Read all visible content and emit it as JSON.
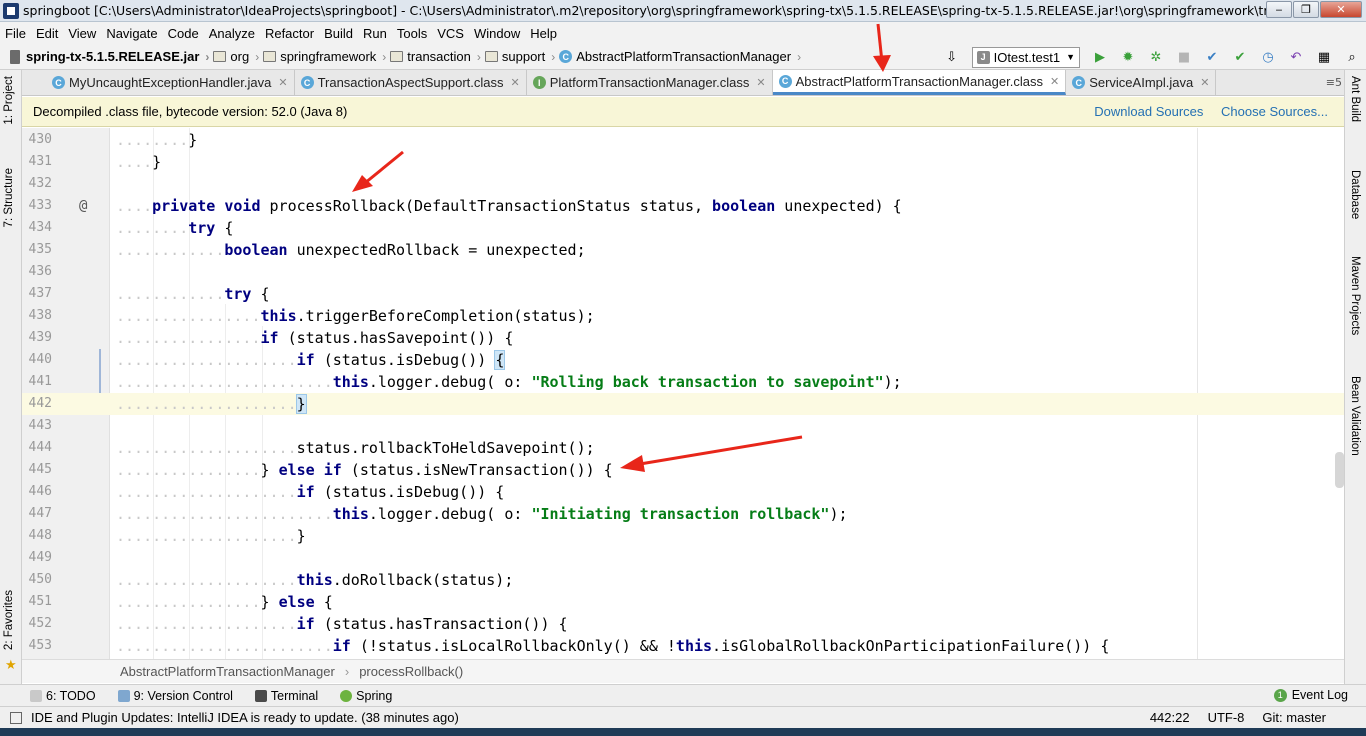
{
  "window": {
    "title": "springboot [C:\\Users\\Administrator\\IdeaProjects\\springboot] - C:\\Users\\Administrator\\.m2\\repository\\org\\springframework\\spring-tx\\5.1.5.RELEASE\\spring-tx-5.1.5.RELEASE.jar!\\org\\springframework\\transaction\\s...",
    "minimize": "‒",
    "maximize": "❐",
    "close": "✕"
  },
  "menu": [
    "File",
    "Edit",
    "View",
    "Navigate",
    "Code",
    "Analyze",
    "Refactor",
    "Build",
    "Run",
    "Tools",
    "VCS",
    "Window",
    "Help"
  ],
  "nav": {
    "jar": "spring-tx-5.1.5.RELEASE.jar",
    "crumbs": [
      "org",
      "springframework",
      "transaction",
      "support"
    ],
    "class": "AbstractPlatformTransactionManager",
    "run_config": "IOtest.test1"
  },
  "left_tabs": {
    "project": "1: Project",
    "structure": "7: Structure",
    "favorites": "2: Favorites"
  },
  "right_tabs": {
    "ant": "Ant Build",
    "database": "Database",
    "maven": "Maven Projects",
    "bean": "Bean Validation"
  },
  "tabs": [
    {
      "label": "MyUncaughtExceptionHandler.java",
      "icon": "C"
    },
    {
      "label": "TransactionAspectSupport.class",
      "icon": "C"
    },
    {
      "label": "PlatformTransactionManager.class",
      "icon": "I"
    },
    {
      "label": "AbstractPlatformTransactionManager.class",
      "icon": "C"
    },
    {
      "label": "ServiceAImpl.java",
      "icon": "C"
    }
  ],
  "tab_overflow": "≡5",
  "banner": {
    "message": "Decompiled .class file, bytecode version: 52.0 (Java 8)",
    "download": "Download Sources",
    "choose": "Choose Sources..."
  },
  "code": [
    {
      "n": "430",
      "t": "        }"
    },
    {
      "n": "431",
      "t": "    }"
    },
    {
      "n": "432",
      "t": ""
    },
    {
      "n": "433",
      "t": "    private void processRollback(DefaultTransactionStatus status, boolean unexpected) {"
    },
    {
      "n": "434",
      "t": "        try {"
    },
    {
      "n": "435",
      "t": "            boolean unexpectedRollback = unexpected;"
    },
    {
      "n": "436",
      "t": ""
    },
    {
      "n": "437",
      "t": "            try {"
    },
    {
      "n": "438",
      "t": "                this.triggerBeforeCompletion(status);"
    },
    {
      "n": "439",
      "t": "                if (status.hasSavepoint()) {"
    },
    {
      "n": "440",
      "t": "                    if (status.isDebug()) {"
    },
    {
      "n": "441",
      "t": "                        this.logger.debug( o: \"Rolling back transaction to savepoint\");"
    },
    {
      "n": "442",
      "t": "                    }"
    },
    {
      "n": "443",
      "t": ""
    },
    {
      "n": "444",
      "t": "                    status.rollbackToHeldSavepoint();"
    },
    {
      "n": "445",
      "t": "                } else if (status.isNewTransaction()) {"
    },
    {
      "n": "446",
      "t": "                    if (status.isDebug()) {"
    },
    {
      "n": "447",
      "t": "                        this.logger.debug( o: \"Initiating transaction rollback\");"
    },
    {
      "n": "448",
      "t": "                    }"
    },
    {
      "n": "449",
      "t": ""
    },
    {
      "n": "450",
      "t": "                    this.doRollback(status);"
    },
    {
      "n": "451",
      "t": "                } else {"
    },
    {
      "n": "452",
      "t": "                    if (status.hasTransaction()) {"
    },
    {
      "n": "453",
      "t": "                        if (!status.isLocalRollbackOnly() && !this.isGlobalRollbackOnParticipationFailure()) {"
    }
  ],
  "editor_breadcrumb": [
    "AbstractPlatformTransactionManager",
    "processRollback()"
  ],
  "toolwindows": [
    {
      "label": "6: TODO"
    },
    {
      "label": "9: Version Control"
    },
    {
      "label": "Terminal"
    },
    {
      "label": "Spring"
    }
  ],
  "event_log": "Event Log",
  "event_count": "1",
  "status": {
    "message": "IDE and Plugin Updates: IntelliJ IDEA is ready to update. (38 minutes ago)",
    "position": "442:22",
    "encoding": "UTF-8",
    "git": "Git: master"
  },
  "colors": {
    "keyword": "#000080",
    "string": "#067d17",
    "accent": "#4a88c7",
    "arrow": "#e8261a"
  }
}
